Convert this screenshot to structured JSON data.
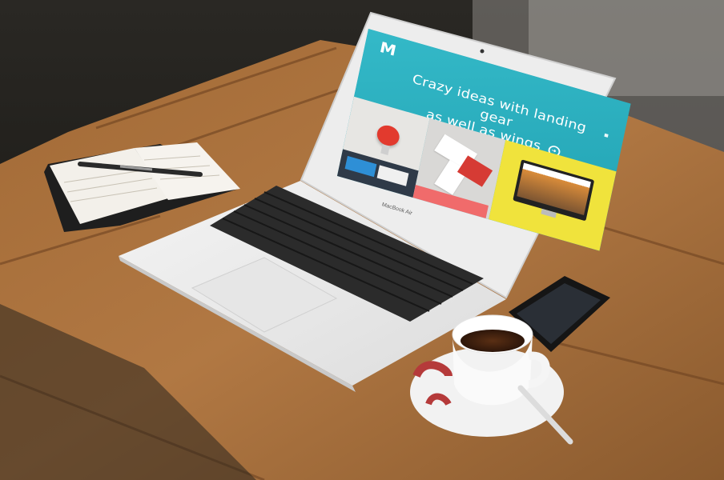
{
  "screen": {
    "logo": "M",
    "headline_line1": "Crazy ideas with landing gear",
    "headline_line2": "as well as wings"
  },
  "laptop": {
    "brand": "MacBook Air"
  }
}
